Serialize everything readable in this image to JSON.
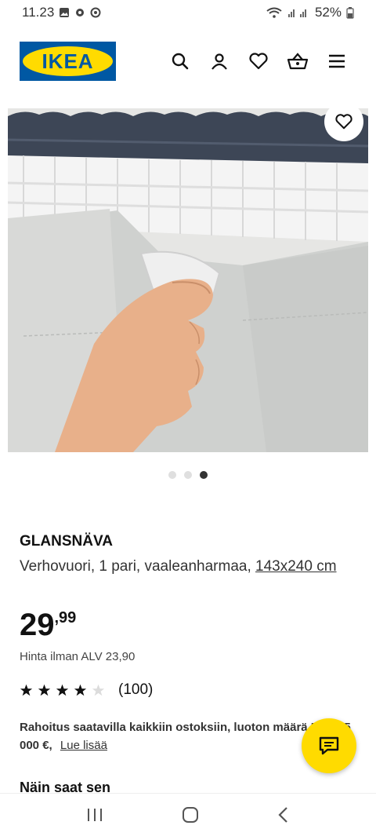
{
  "status": {
    "time": "11.23",
    "battery": "52%"
  },
  "header": {
    "logo_text": "IKEA",
    "icons": [
      "search-icon",
      "user-icon",
      "heart-icon",
      "basket-icon",
      "menu-icon"
    ]
  },
  "gallery": {
    "slide_count": 3,
    "active_slide": 3
  },
  "product": {
    "brand": "GLANSNÄVA",
    "description": "Verhovuori, 1 pari, vaaleanharmaa,",
    "size": "143x240 cm",
    "price_int": "29",
    "price_dec": ",99",
    "vat_text": "Hinta ilman ALV 23,90",
    "rating": 4,
    "rating_max": 5,
    "review_count": "(100)"
  },
  "finance": {
    "text": "Rahoitus saatavilla kaikkiin ostoksiin, luoton määrä 500 -25 000 €,",
    "more": "Lue lisää"
  },
  "section": {
    "title": "Näin saat sen"
  },
  "colors": {
    "ikea_blue": "#0058a3",
    "ikea_yellow": "#ffdb00"
  }
}
